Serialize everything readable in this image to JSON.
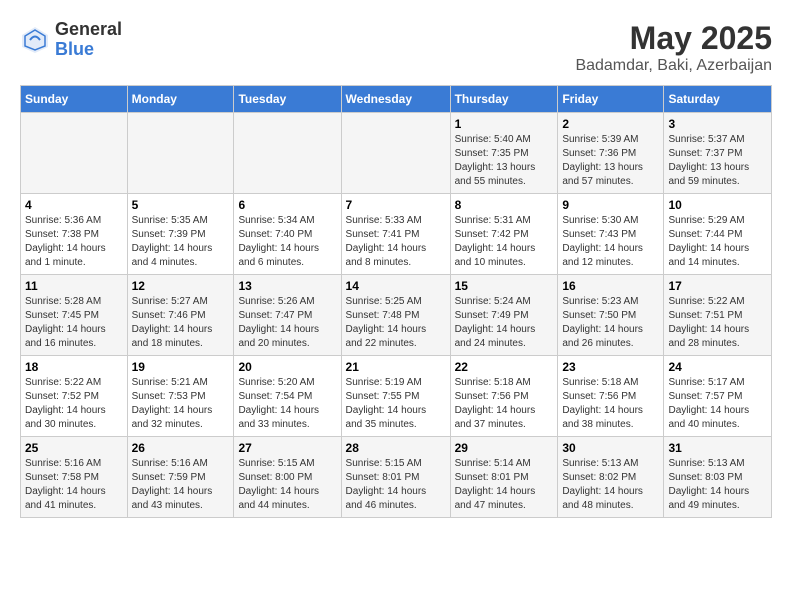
{
  "logo": {
    "general": "General",
    "blue": "Blue"
  },
  "header": {
    "title": "May 2025",
    "subtitle": "Badamdar, Baki, Azerbaijan"
  },
  "days_of_week": [
    "Sunday",
    "Monday",
    "Tuesday",
    "Wednesday",
    "Thursday",
    "Friday",
    "Saturday"
  ],
  "weeks": [
    [
      {
        "day": "",
        "info": ""
      },
      {
        "day": "",
        "info": ""
      },
      {
        "day": "",
        "info": ""
      },
      {
        "day": "",
        "info": ""
      },
      {
        "day": "1",
        "info": "Sunrise: 5:40 AM\nSunset: 7:35 PM\nDaylight: 13 hours\nand 55 minutes."
      },
      {
        "day": "2",
        "info": "Sunrise: 5:39 AM\nSunset: 7:36 PM\nDaylight: 13 hours\nand 57 minutes."
      },
      {
        "day": "3",
        "info": "Sunrise: 5:37 AM\nSunset: 7:37 PM\nDaylight: 13 hours\nand 59 minutes."
      }
    ],
    [
      {
        "day": "4",
        "info": "Sunrise: 5:36 AM\nSunset: 7:38 PM\nDaylight: 14 hours\nand 1 minute."
      },
      {
        "day": "5",
        "info": "Sunrise: 5:35 AM\nSunset: 7:39 PM\nDaylight: 14 hours\nand 4 minutes."
      },
      {
        "day": "6",
        "info": "Sunrise: 5:34 AM\nSunset: 7:40 PM\nDaylight: 14 hours\nand 6 minutes."
      },
      {
        "day": "7",
        "info": "Sunrise: 5:33 AM\nSunset: 7:41 PM\nDaylight: 14 hours\nand 8 minutes."
      },
      {
        "day": "8",
        "info": "Sunrise: 5:31 AM\nSunset: 7:42 PM\nDaylight: 14 hours\nand 10 minutes."
      },
      {
        "day": "9",
        "info": "Sunrise: 5:30 AM\nSunset: 7:43 PM\nDaylight: 14 hours\nand 12 minutes."
      },
      {
        "day": "10",
        "info": "Sunrise: 5:29 AM\nSunset: 7:44 PM\nDaylight: 14 hours\nand 14 minutes."
      }
    ],
    [
      {
        "day": "11",
        "info": "Sunrise: 5:28 AM\nSunset: 7:45 PM\nDaylight: 14 hours\nand 16 minutes."
      },
      {
        "day": "12",
        "info": "Sunrise: 5:27 AM\nSunset: 7:46 PM\nDaylight: 14 hours\nand 18 minutes."
      },
      {
        "day": "13",
        "info": "Sunrise: 5:26 AM\nSunset: 7:47 PM\nDaylight: 14 hours\nand 20 minutes."
      },
      {
        "day": "14",
        "info": "Sunrise: 5:25 AM\nSunset: 7:48 PM\nDaylight: 14 hours\nand 22 minutes."
      },
      {
        "day": "15",
        "info": "Sunrise: 5:24 AM\nSunset: 7:49 PM\nDaylight: 14 hours\nand 24 minutes."
      },
      {
        "day": "16",
        "info": "Sunrise: 5:23 AM\nSunset: 7:50 PM\nDaylight: 14 hours\nand 26 minutes."
      },
      {
        "day": "17",
        "info": "Sunrise: 5:22 AM\nSunset: 7:51 PM\nDaylight: 14 hours\nand 28 minutes."
      }
    ],
    [
      {
        "day": "18",
        "info": "Sunrise: 5:22 AM\nSunset: 7:52 PM\nDaylight: 14 hours\nand 30 minutes."
      },
      {
        "day": "19",
        "info": "Sunrise: 5:21 AM\nSunset: 7:53 PM\nDaylight: 14 hours\nand 32 minutes."
      },
      {
        "day": "20",
        "info": "Sunrise: 5:20 AM\nSunset: 7:54 PM\nDaylight: 14 hours\nand 33 minutes."
      },
      {
        "day": "21",
        "info": "Sunrise: 5:19 AM\nSunset: 7:55 PM\nDaylight: 14 hours\nand 35 minutes."
      },
      {
        "day": "22",
        "info": "Sunrise: 5:18 AM\nSunset: 7:56 PM\nDaylight: 14 hours\nand 37 minutes."
      },
      {
        "day": "23",
        "info": "Sunrise: 5:18 AM\nSunset: 7:56 PM\nDaylight: 14 hours\nand 38 minutes."
      },
      {
        "day": "24",
        "info": "Sunrise: 5:17 AM\nSunset: 7:57 PM\nDaylight: 14 hours\nand 40 minutes."
      }
    ],
    [
      {
        "day": "25",
        "info": "Sunrise: 5:16 AM\nSunset: 7:58 PM\nDaylight: 14 hours\nand 41 minutes."
      },
      {
        "day": "26",
        "info": "Sunrise: 5:16 AM\nSunset: 7:59 PM\nDaylight: 14 hours\nand 43 minutes."
      },
      {
        "day": "27",
        "info": "Sunrise: 5:15 AM\nSunset: 8:00 PM\nDaylight: 14 hours\nand 44 minutes."
      },
      {
        "day": "28",
        "info": "Sunrise: 5:15 AM\nSunset: 8:01 PM\nDaylight: 14 hours\nand 46 minutes."
      },
      {
        "day": "29",
        "info": "Sunrise: 5:14 AM\nSunset: 8:01 PM\nDaylight: 14 hours\nand 47 minutes."
      },
      {
        "day": "30",
        "info": "Sunrise: 5:13 AM\nSunset: 8:02 PM\nDaylight: 14 hours\nand 48 minutes."
      },
      {
        "day": "31",
        "info": "Sunrise: 5:13 AM\nSunset: 8:03 PM\nDaylight: 14 hours\nand 49 minutes."
      }
    ]
  ]
}
